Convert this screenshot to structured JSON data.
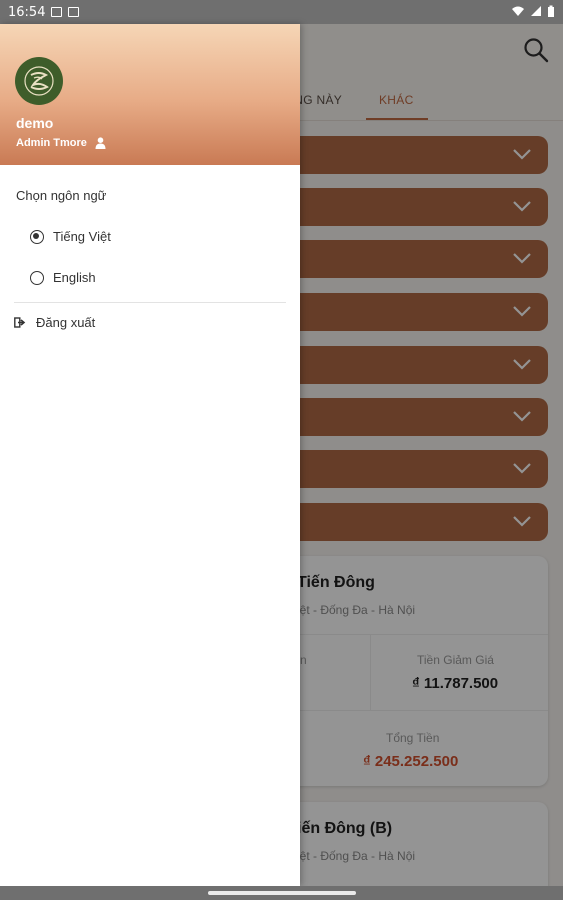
{
  "status_bar": {
    "time": "16:54"
  },
  "app": {
    "tabs": [
      {
        "label": "ÀNG NÀY",
        "active": false
      },
      {
        "label": "KHÁC",
        "active": true
      }
    ],
    "accordion_count": 8,
    "cards": [
      {
        "name": "Tiến Đông",
        "address": "iệt - Đống Đa - Hà Nội",
        "partial_label": "n",
        "discount_label": "Tiền Giảm Giá",
        "discount_value": "₫ 11.787.500",
        "total_label": "Tổng Tiền",
        "total_value": "₫ 245.252.500"
      },
      {
        "name": "iến Đông (B)",
        "address": "iệt - Đống Đa - Hà Nội"
      }
    ]
  },
  "drawer": {
    "user_name": "demo",
    "user_role": "Admin Tmore",
    "language_title": "Chọn ngôn ngữ",
    "languages": [
      {
        "label": "Tiếng Việt",
        "selected": true
      },
      {
        "label": "English",
        "selected": false
      }
    ],
    "logout_label": "Đăng xuất"
  },
  "colors": {
    "accent": "#c06a43",
    "accordion": "#b06a45",
    "total": "#d2502e",
    "avatar_bg": "#3e5d2a"
  }
}
